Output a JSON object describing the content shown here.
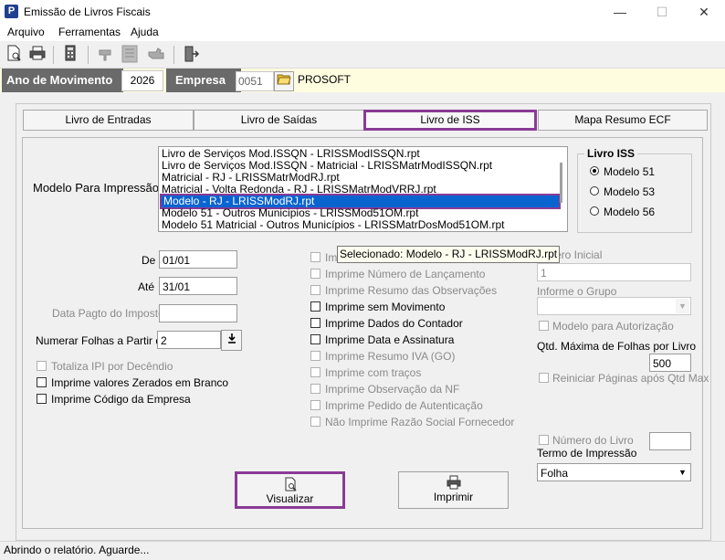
{
  "window": {
    "title": "Emissão de Livros Fiscais",
    "icon_letter": "P",
    "controls": {
      "minimize": "—",
      "maximize": "☐",
      "close": "✕"
    }
  },
  "menu": [
    "Arquivo",
    "Ferramentas",
    "Ajuda"
  ],
  "toolbar": {
    "icons": [
      "new-document-icon",
      "print-icon",
      "calculator-icon",
      "hand-icon",
      "notes-icon",
      "pointing-hand-icon",
      "exit-door-icon"
    ]
  },
  "header": {
    "ano_label": "Ano de Movimento",
    "ano_value": "2026",
    "empresa_label": "Empresa",
    "empresa_code": "0051",
    "empresa_name": "PROSOFT"
  },
  "tabs": [
    "Livro de Entradas",
    "Livro de Saídas",
    "Livro de ISS",
    "Mapa Resumo ECF"
  ],
  "active_tab": "Livro de ISS",
  "modelo": {
    "label": "Modelo Para Impressão",
    "items": [
      "Livro de Serviços Mod.ISSQN - LRISSModISSQN.rpt",
      "Livro de Serviços Mod.ISSQN - Matricial - LRISSMatrModISSQN.rpt",
      "Matricial - RJ - LRISSMatrModRJ.rpt",
      "Matricial - Volta Redonda - RJ - LRISSMatrModVRRJ.rpt",
      "Modelo - RJ - LRISSModRJ.rpt",
      "Modelo 51 - Outros Municipios - LRISSMod51OM.rpt",
      "Modelo 51 Matricial - Outros Municípios - LRISSMatrDosMod51OM.rpt"
    ],
    "selected_index": 4
  },
  "livro_iss": {
    "title": "Livro ISS",
    "options": [
      "Modelo 51",
      "Modelo 53",
      "Modelo 56"
    ],
    "selected": "Modelo 51"
  },
  "tooltip": "Selecionado: Modelo - RJ - LRISSModRJ.rpt",
  "fields": {
    "de_label": "De",
    "de_value": "01/01",
    "ate_label": "Até",
    "ate_value": "31/01",
    "data_pagto_label": "Data Pagto do Imposto",
    "data_pagto_value": "",
    "numerar_label": "Numerar Folhas a Partir de",
    "numerar_value": "2"
  },
  "left_checks": [
    {
      "label": "Totaliza IPI por Decêndio",
      "enabled": false,
      "checked": false
    },
    {
      "label": "Imprime valores Zerados em Branco",
      "enabled": true,
      "checked": false
    },
    {
      "label": "Imprime Código da Empresa",
      "enabled": true,
      "checked": false
    }
  ],
  "middle_checks": [
    {
      "label": "Im",
      "enabled": false,
      "checked": false
    },
    {
      "label": "Imprime Número de Lançamento",
      "enabled": false,
      "checked": false
    },
    {
      "label": "Imprime Resumo das Observações",
      "enabled": false,
      "checked": false
    },
    {
      "label": "Imprime sem Movimento",
      "enabled": true,
      "checked": false
    },
    {
      "label": "Imprime Dados do Contador",
      "enabled": true,
      "checked": false
    },
    {
      "label": "Imprime Data e Assinatura",
      "enabled": true,
      "checked": false
    },
    {
      "label": "Imprime Resumo IVA (GO)",
      "enabled": false,
      "checked": false
    },
    {
      "label": "Imprime com traços",
      "enabled": false,
      "checked": false
    },
    {
      "label": "Imprime Observação da NF",
      "enabled": false,
      "checked": false
    },
    {
      "label": "Imprime Pedido de Autenticação",
      "enabled": false,
      "checked": false
    },
    {
      "label": "Não Imprime Razão Social Fornecedor",
      "enabled": false,
      "checked": false
    }
  ],
  "right": {
    "numero_inicial_label": "mero Inicial",
    "numero_inicial_value": "1",
    "grupo_label": "Informe o Grupo",
    "grupo_value": "",
    "modelo_autorizacao_label": "Modelo para Autorização",
    "qtd_max_label": "Qtd. Máxima de Folhas por Livro",
    "qtd_max_value": "500",
    "reiniciar_label": "Reiniciar Páginas após Qtd Max",
    "numero_livro_label": "Número do Livro",
    "numero_livro_value": "",
    "termo_label": "Termo de Impressão",
    "termo_value": "Folha"
  },
  "buttons": {
    "visualizar": "Visualizar",
    "imprimir": "Imprimir"
  },
  "status": "Abrindo o relatório. Aguarde...",
  "colors": {
    "accent_highlight": "#8a3b96",
    "selection": "#0a64d0",
    "header_label_bg": "#6a6a6a",
    "header_strip_bg": "#fffde0"
  }
}
